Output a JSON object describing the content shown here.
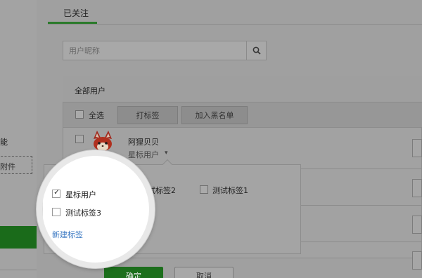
{
  "sidebar": {
    "feature_text": "能",
    "attachment_text": "附件"
  },
  "header": {
    "active_tab": "已关注"
  },
  "search": {
    "placeholder": "用户昵称",
    "icon": "search-icon"
  },
  "users_panel": {
    "title": "全部用户",
    "select_all": "全选",
    "tag_button": "打标签",
    "blacklist_button": "加入黑名单"
  },
  "user_row": {
    "name": "阿狸贝贝",
    "tag": "星标用户",
    "avatar_icon": "fox-avatar-icon"
  },
  "tag_popover": {
    "tags": [
      {
        "label": "星标用户",
        "checked": true
      },
      {
        "label": "测试标签3",
        "checked": false
      },
      {
        "label": "测试标签2",
        "checked": false
      },
      {
        "label": "测试标签1",
        "checked": false
      }
    ],
    "new_tag_link": "新建标签",
    "confirm_button": "确定",
    "cancel_button": "取消"
  },
  "colors": {
    "accent_green": "#2b7a2b",
    "link_blue": "#3a78c2",
    "overlay_gray": "#9b9b9b"
  }
}
